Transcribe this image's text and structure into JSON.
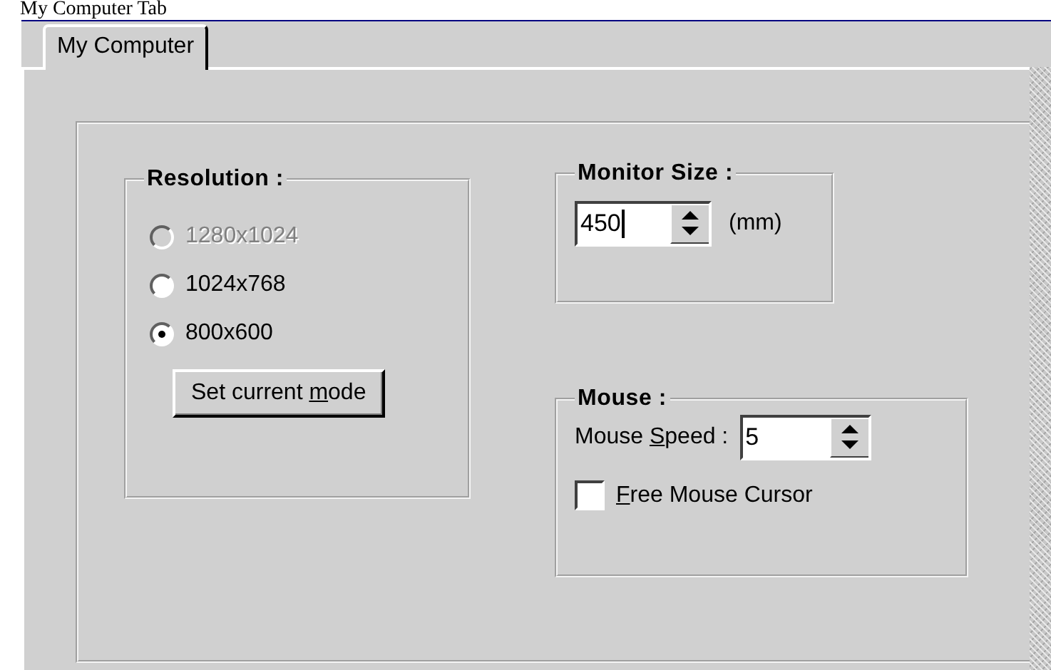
{
  "caption": "My Computer Tab",
  "tabs": [
    {
      "label": "My Computer",
      "selected": true
    }
  ],
  "resolution": {
    "title": "Resolution :",
    "options": [
      {
        "label": "1280x1024",
        "selected": false,
        "disabled": true
      },
      {
        "label": "1024x768",
        "selected": false,
        "disabled": false
      },
      {
        "label": "800x600",
        "selected": true,
        "disabled": false
      }
    ],
    "button": {
      "before": "Set current ",
      "key": "m",
      "after": "ode"
    }
  },
  "monitor_size": {
    "title": "Monitor Size :",
    "value": "450",
    "focused": true,
    "unit": "(mm)"
  },
  "mouse": {
    "title": "Mouse :",
    "speed_label": {
      "before": "Mouse ",
      "key": "S",
      "after": "peed :"
    },
    "speed_value": "5",
    "free_cursor": {
      "label": {
        "key": "F",
        "after": "ree Mouse Cursor"
      },
      "checked": false
    }
  }
}
